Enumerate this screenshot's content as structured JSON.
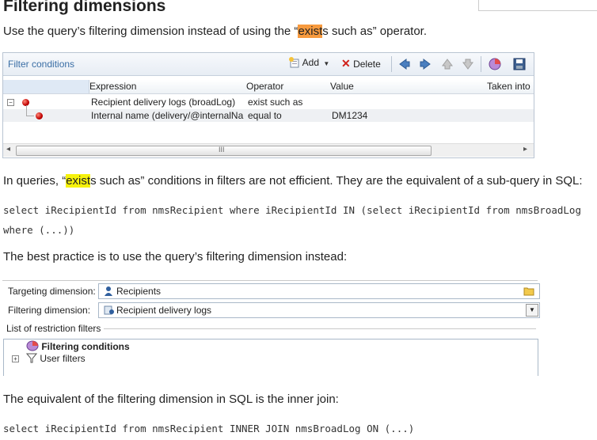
{
  "heading": "Filtering dimensions",
  "intro": {
    "before": "Use the query’s filtering dimension instead of using the “",
    "hl_a": "exist",
    "hl_b": "s",
    "after": " such as” operator."
  },
  "filter_panel": {
    "title": "Filter conditions",
    "add_label": "Add",
    "delete_label": "Delete",
    "columns": [
      "Expression",
      "Operator",
      "Value",
      "Taken into"
    ],
    "rows": [
      {
        "expression": "Recipient delivery logs (broadLog)",
        "operator": "exist such as",
        "value": ""
      },
      {
        "expression": "Internal name (delivery/@internalNa",
        "operator": "equal to",
        "value": "DM1234"
      }
    ],
    "scroll_grip": "III"
  },
  "para2": {
    "before": "In queries, “",
    "hl_a": "exist",
    "hl_b": "s",
    "after": " such as” conditions in filters are not efficient. They are the equivalent of a sub-query in SQL:"
  },
  "code1_line1": "select iRecipientId from nmsRecipient where iRecipientId IN (select iRecipientId from nmsBroadLog",
  "code1_line2": "where (...))",
  "para3": "The best practice is to use the query’s filtering dimension instead:",
  "targeting_panel": {
    "targeting_label": "Targeting dimension:",
    "targeting_value": "Recipients",
    "filtering_label": "Filtering dimension:",
    "filtering_value": "Recipient delivery logs",
    "restriction_label": "List of restriction filters",
    "tree": [
      "Filtering conditions",
      "User filters"
    ]
  },
  "para4": "The equivalent of the filtering dimension in SQL is the inner join:",
  "code2": "select iRecipientId from nmsRecipient INNER JOIN nmsBroadLog ON (...)"
}
